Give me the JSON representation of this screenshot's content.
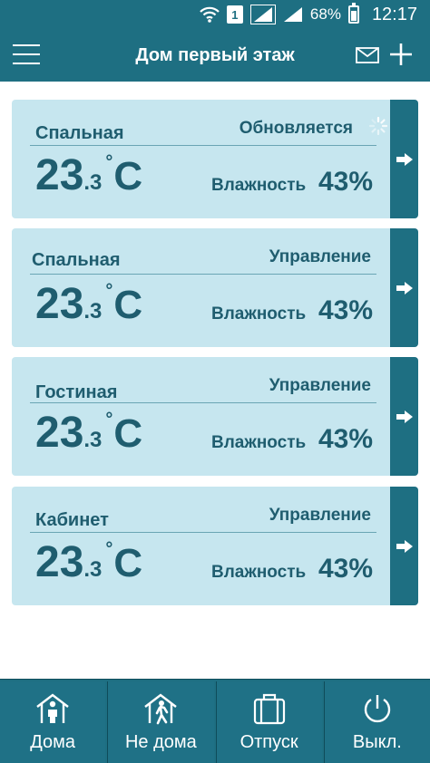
{
  "status_bar": {
    "sim_label": "1",
    "battery": "68%",
    "time": "12:17",
    "icons": [
      "wifi-icon",
      "sim-icon",
      "signal-icon",
      "signal-icon",
      "battery-icon"
    ]
  },
  "app_bar": {
    "title": "Дом первый этаж",
    "icons": [
      "menu-icon",
      "mail-icon",
      "plus-icon"
    ]
  },
  "rooms": [
    {
      "name": "Спальная",
      "status": "Обновляется",
      "loading": true,
      "temp_int": "23",
      "temp_dec": ".3",
      "deg": "°",
      "unit": "C",
      "humidity_label": "Влажность",
      "humidity": "43%"
    },
    {
      "name": "Спальная",
      "status": "Управление",
      "loading": false,
      "temp_int": "23",
      "temp_dec": ".3",
      "deg": "°",
      "unit": "C",
      "humidity_label": "Влажность",
      "humidity": "43%"
    },
    {
      "name": "Гостиная",
      "status": "Управление",
      "loading": false,
      "temp_int": "23",
      "temp_dec": ".3",
      "deg": "°",
      "unit": "C",
      "humidity_label": "Влажность",
      "humidity": "43%"
    },
    {
      "name": "Кабинет",
      "status": "Управление",
      "loading": false,
      "temp_int": "23",
      "temp_dec": ".3",
      "deg": "°",
      "unit": "C",
      "humidity_label": "Влажность",
      "humidity": "43%"
    }
  ],
  "bottom_nav": [
    {
      "label": "Дома",
      "icon": "home-person-icon"
    },
    {
      "label": "Не дома",
      "icon": "home-away-icon"
    },
    {
      "label": "Отпуск",
      "icon": "suitcase-icon"
    },
    {
      "label": "Выкл.",
      "icon": "power-icon"
    }
  ],
  "colors": {
    "primary": "#1e6f82",
    "card": "#c6e6ef",
    "text": "#1f5d6f"
  }
}
